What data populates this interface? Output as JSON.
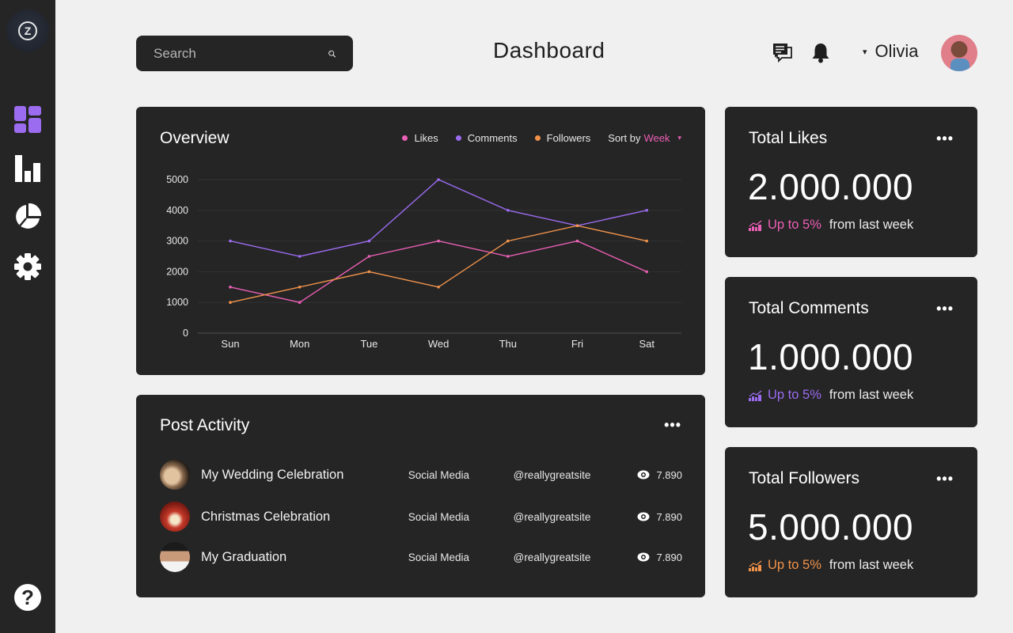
{
  "app": {
    "title": "Dashboard"
  },
  "sidebar": {
    "logo_letter": "Z",
    "items": [
      {
        "name": "dashboard",
        "icon": "dashboard-grid-icon",
        "active": true
      },
      {
        "name": "analytics",
        "icon": "bar-chart-icon",
        "active": false
      },
      {
        "name": "reports",
        "icon": "pie-chart-icon",
        "active": false
      },
      {
        "name": "settings",
        "icon": "gear-icon",
        "active": false
      }
    ],
    "help_glyph": "?"
  },
  "header": {
    "search_placeholder": "Search",
    "title": "Dashboard",
    "user_name": "Olivia",
    "caret": "▾"
  },
  "colors": {
    "likes": "#ec5fb6",
    "comments": "#9b6bf0",
    "followers": "#f0924a",
    "accent": "#9b6bf0"
  },
  "overview": {
    "title": "Overview",
    "legend": [
      {
        "label": "Likes",
        "key": "likes"
      },
      {
        "label": "Comments",
        "key": "comments"
      },
      {
        "label": "Followers",
        "key": "followers"
      }
    ],
    "sort_label": "Sort by",
    "sort_value": "Week",
    "sort_caret": "▾"
  },
  "chart_data": {
    "type": "line",
    "title": "Overview",
    "xlabel": "",
    "ylabel": "",
    "categories": [
      "Sun",
      "Mon",
      "Tue",
      "Wed",
      "Thu",
      "Fri",
      "Sat"
    ],
    "yticks": [
      0,
      1000,
      2000,
      3000,
      4000,
      5000
    ],
    "ylim": [
      0,
      5000
    ],
    "grid": true,
    "legend_position": "top-right",
    "series": [
      {
        "name": "Likes",
        "color": "#ec5fb6",
        "values": [
          1500,
          1000,
          2500,
          3000,
          2500,
          3000,
          2000
        ]
      },
      {
        "name": "Comments",
        "color": "#9b6bf0",
        "values": [
          3000,
          2500,
          3000,
          5000,
          4000,
          3500,
          4000
        ]
      },
      {
        "name": "Followers",
        "color": "#f0924a",
        "values": [
          1000,
          1500,
          2000,
          1500,
          3000,
          3500,
          3000
        ]
      }
    ]
  },
  "activity": {
    "title": "Post Activity",
    "more": "•••",
    "rows": [
      {
        "name": "My Wedding Celebration",
        "category": "Social Media",
        "handle": "@reallygreatsite",
        "views": "7.890",
        "thumb": "wedding"
      },
      {
        "name": "Christmas Celebration",
        "category": "Social Media",
        "handle": "@reallygreatsite",
        "views": "7.890",
        "thumb": "christmas"
      },
      {
        "name": "My Graduation",
        "category": "Social Media",
        "handle": "@reallygreatsite",
        "views": "7.890",
        "thumb": "graduation"
      }
    ]
  },
  "stats": [
    {
      "title": "Total Likes",
      "value": "2.000.000",
      "trend_up": "Up to 5%",
      "trend_rest": "from last week",
      "color": "#ec5fb6",
      "more": "•••"
    },
    {
      "title": "Total Comments",
      "value": "1.000.000",
      "trend_up": "Up to 5%",
      "trend_rest": "from last week",
      "color": "#9b6bf0",
      "more": "•••"
    },
    {
      "title": "Total Followers",
      "value": "5.000.000",
      "trend_up": "Up to 5%",
      "trend_rest": "from last week",
      "color": "#f0924a",
      "more": "•••"
    }
  ]
}
